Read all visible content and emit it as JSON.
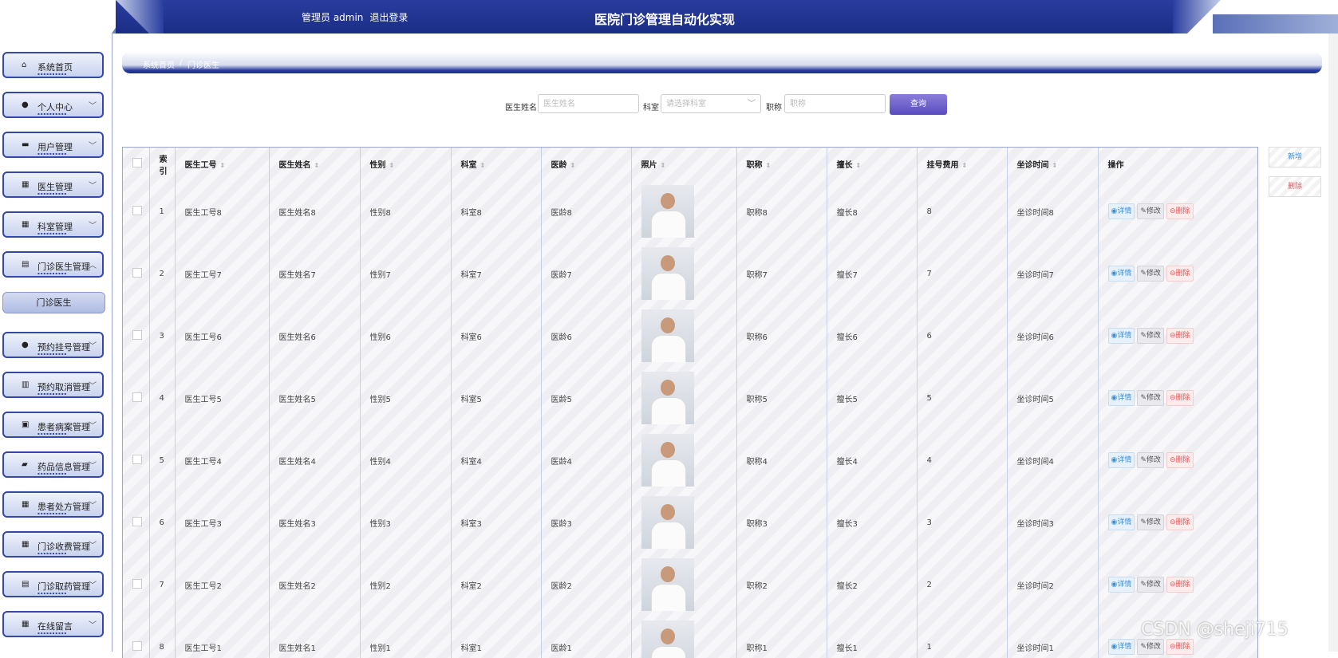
{
  "header": {
    "user_label": "管理员 admin",
    "logout": "退出登录",
    "title": "医院门诊管理自动化实现"
  },
  "sidebar": {
    "items": [
      {
        "label": "系统首页",
        "icon": "home-icon",
        "glyph": "⌂",
        "chevron": ""
      },
      {
        "label": "个人中心",
        "icon": "user-icon",
        "glyph": "●",
        "chevron": "﹀"
      },
      {
        "label": "用户管理",
        "icon": "briefcase-icon",
        "glyph": "▬",
        "chevron": "﹀"
      },
      {
        "label": "医生管理",
        "icon": "grid-icon",
        "glyph": "▦",
        "chevron": "﹀"
      },
      {
        "label": "科室管理",
        "icon": "grid-icon",
        "glyph": "▦",
        "chevron": "﹀"
      },
      {
        "label": "门诊医生管理",
        "icon": "document-icon",
        "glyph": "▤",
        "chevron": "︿"
      },
      {
        "label": "预约挂号管理",
        "icon": "user-icon",
        "glyph": "●",
        "chevron": "﹀"
      },
      {
        "label": "预约取消管理",
        "icon": "chart-icon",
        "glyph": "▥",
        "chevron": "﹀"
      },
      {
        "label": "患者病案管理",
        "icon": "clipboard-icon",
        "glyph": "▣",
        "chevron": "﹀"
      },
      {
        "label": "药品信息管理",
        "icon": "wallet-icon",
        "glyph": "▰",
        "chevron": "﹀"
      },
      {
        "label": "患者处方管理",
        "icon": "grid-icon",
        "glyph": "▦",
        "chevron": "﹀"
      },
      {
        "label": "门诊收费管理",
        "icon": "grid-icon",
        "glyph": "▦",
        "chevron": "﹀"
      },
      {
        "label": "门诊取药管理",
        "icon": "document-icon",
        "glyph": "▤",
        "chevron": "﹀"
      },
      {
        "label": "在线留言",
        "icon": "grid-icon",
        "glyph": "▦",
        "chevron": "﹀"
      }
    ],
    "submenu_label": "门诊医生"
  },
  "breadcrumb": {
    "home": "系统首页",
    "separator": "/",
    "current": "门诊医生"
  },
  "search": {
    "name_label": "医生姓名",
    "name_placeholder": "医生姓名",
    "dept_label": "科室",
    "dept_placeholder": "请选择科室",
    "title_label": "职称",
    "title_placeholder": "职称",
    "button": "查询"
  },
  "actions": {
    "add": "新增",
    "delete": "删除"
  },
  "table": {
    "headers": [
      "索引",
      "医生工号",
      "医生姓名",
      "性别",
      "科室",
      "医龄",
      "照片",
      "职称",
      "擅长",
      "挂号费用",
      "坐诊时间",
      "操作"
    ],
    "row_actions": {
      "detail": "详情",
      "edit": "修改",
      "delete": "删除"
    },
    "rows": [
      {
        "index": "1",
        "id": "医生工号8",
        "name": "医生姓名8",
        "gender": "性别8",
        "dept": "科室8",
        "age": "医龄8",
        "title": "职称8",
        "skill": "擅长8",
        "fee": "8",
        "time": "坐诊时间8"
      },
      {
        "index": "2",
        "id": "医生工号7",
        "name": "医生姓名7",
        "gender": "性别7",
        "dept": "科室7",
        "age": "医龄7",
        "title": "职称7",
        "skill": "擅长7",
        "fee": "7",
        "time": "坐诊时间7"
      },
      {
        "index": "3",
        "id": "医生工号6",
        "name": "医生姓名6",
        "gender": "性别6",
        "dept": "科室6",
        "age": "医龄6",
        "title": "职称6",
        "skill": "擅长6",
        "fee": "6",
        "time": "坐诊时间6"
      },
      {
        "index": "4",
        "id": "医生工号5",
        "name": "医生姓名5",
        "gender": "性别5",
        "dept": "科室5",
        "age": "医龄5",
        "title": "职称5",
        "skill": "擅长5",
        "fee": "5",
        "time": "坐诊时间5"
      },
      {
        "index": "5",
        "id": "医生工号4",
        "name": "医生姓名4",
        "gender": "性别4",
        "dept": "科室4",
        "age": "医龄4",
        "title": "职称4",
        "skill": "擅长4",
        "fee": "4",
        "time": "坐诊时间4"
      },
      {
        "index": "6",
        "id": "医生工号3",
        "name": "医生姓名3",
        "gender": "性别3",
        "dept": "科室3",
        "age": "医龄3",
        "title": "职称3",
        "skill": "擅长3",
        "fee": "3",
        "time": "坐诊时间3"
      },
      {
        "index": "7",
        "id": "医生工号2",
        "name": "医生姓名2",
        "gender": "性别2",
        "dept": "科室2",
        "age": "医龄2",
        "title": "职称2",
        "skill": "擅长2",
        "fee": "2",
        "time": "坐诊时间2"
      },
      {
        "index": "8",
        "id": "医生工号1",
        "name": "医生姓名1",
        "gender": "性别1",
        "dept": "科室1",
        "age": "医龄1",
        "title": "职称1",
        "skill": "擅长1",
        "fee": "1",
        "time": "坐诊时间1"
      }
    ]
  },
  "watermark": "CSDN @sheji715",
  "colors": {
    "header": "#1a2d85",
    "accent": "#3348a8",
    "query_button": "#6a5bcb",
    "detail": "#3b8ed8",
    "delete": "#e0575b"
  }
}
